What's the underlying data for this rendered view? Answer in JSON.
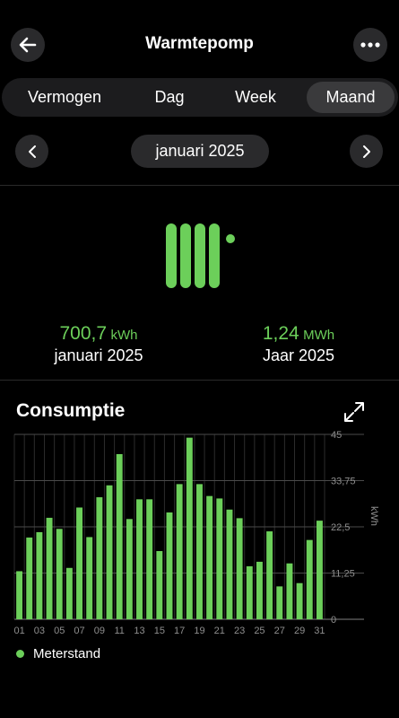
{
  "header": {
    "title": "Warmtepomp",
    "back_icon": "arrow-left-icon",
    "more_icon": "more-horizontal-icon"
  },
  "tabs": [
    {
      "label": "Vermogen",
      "active": false
    },
    {
      "label": "Dag",
      "active": false
    },
    {
      "label": "Week",
      "active": false
    },
    {
      "label": "Maand",
      "active": true
    }
  ],
  "date_nav": {
    "label": "januari 2025",
    "prev_icon": "chevron-left-icon",
    "next_icon": "chevron-right-icon"
  },
  "device": {
    "icon": "radiator-icon",
    "accent_color": "#6ccf5a"
  },
  "stats": {
    "month": {
      "value": "700,7",
      "unit": "kWh",
      "label": "januari 2025"
    },
    "year": {
      "value": "1,24",
      "unit": "MWh",
      "label": "Jaar 2025"
    }
  },
  "consumption": {
    "title": "Consumptie",
    "expand_icon": "expand-icon",
    "legend": "Meterstand"
  },
  "chart_data": {
    "type": "bar",
    "title": "Consumptie",
    "xlabel": "",
    "ylabel": "kWh",
    "ylim": [
      0,
      45
    ],
    "y_ticks": [
      "0",
      "11,25",
      "22,5",
      "33,75",
      "45"
    ],
    "x_tick_labels": [
      "01",
      "03",
      "05",
      "07",
      "09",
      "11",
      "13",
      "15",
      "17",
      "19",
      "21",
      "23",
      "25",
      "27",
      "29",
      "31"
    ],
    "categories": [
      "01",
      "02",
      "03",
      "04",
      "05",
      "06",
      "07",
      "08",
      "09",
      "10",
      "11",
      "12",
      "13",
      "14",
      "15",
      "16",
      "17",
      "18",
      "19",
      "20",
      "21",
      "22",
      "23",
      "24",
      "25",
      "26",
      "27",
      "28",
      "29",
      "30",
      "31"
    ],
    "series": [
      {
        "name": "Meterstand",
        "color": "#6ccf5a",
        "values": [
          11.7,
          19.9,
          21.2,
          24.7,
          22.0,
          12.5,
          27.2,
          20.0,
          29.7,
          32.6,
          40.2,
          24.4,
          29.2,
          29.2,
          16.6,
          26.0,
          32.9,
          44.2,
          32.9,
          30.0,
          29.4,
          26.7,
          24.6,
          12.9,
          14.0,
          21.4,
          8.0,
          13.6,
          8.8,
          19.3,
          24.0
        ]
      }
    ],
    "grid": true,
    "legend_position": "bottom-left"
  }
}
